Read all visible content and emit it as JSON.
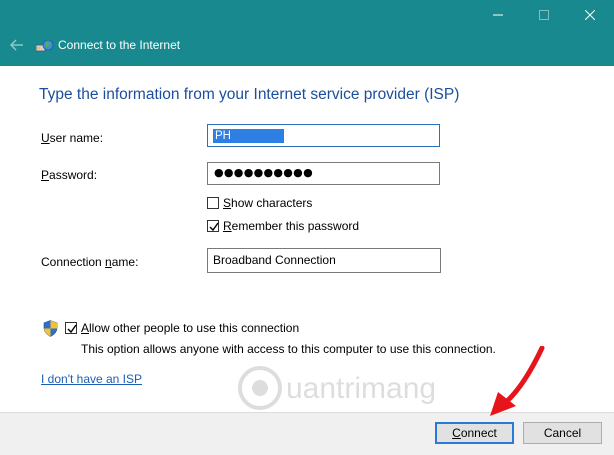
{
  "window": {
    "title": "Connect to the Internet",
    "controls": {
      "minimize": "—",
      "maximize": "☐",
      "close": "✕"
    }
  },
  "heading": "Type the information from your Internet service provider (ISP)",
  "form": {
    "username": {
      "label_first": "U",
      "label_rest": "ser name:",
      "value": "PH"
    },
    "password": {
      "label_first": "P",
      "label_rest": "assword:",
      "masked_value": "●●●●●●●●●●"
    },
    "show_characters": {
      "label_first": "S",
      "label_rest": "how characters",
      "checked": false
    },
    "remember_password": {
      "label_first": "R",
      "label_rest": "emember this password",
      "checked": true
    },
    "connection_name": {
      "label_before": "Connection ",
      "label_underlined": "n",
      "label_after": "ame:",
      "value": "Broadband Connection"
    }
  },
  "allow_others": {
    "label_first": "A",
    "label_rest": "llow other people to use this connection",
    "checked": true,
    "description": "This option allows anyone with access to this computer to use this connection."
  },
  "no_isp_link": "I don't have an ISP",
  "buttons": {
    "connect_first": "C",
    "connect_rest": "onnect",
    "cancel": "Cancel"
  },
  "watermark": "Quantrimang",
  "colors": {
    "titlebar": "#188a8f",
    "heading": "#1b4e9c",
    "link": "#1a5fb4",
    "arrow": "#e8141b"
  }
}
